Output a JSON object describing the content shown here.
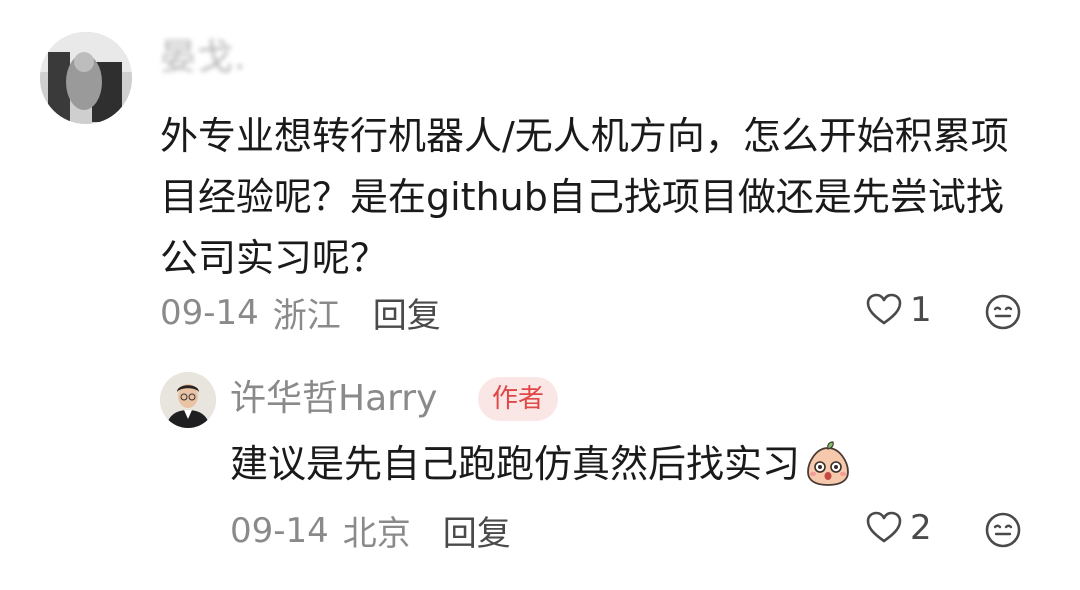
{
  "comment": {
    "username": "晏戈.",
    "text": "外专业想转行机器人/无人机方向，怎么开始积累项目经验呢？是在github自己找项目做还是先尝试找公司实习呢？",
    "date": "09-14",
    "region": "浙江",
    "reply_label": "回复",
    "likes": "1",
    "icons": {
      "like": "heart-outline-icon",
      "react": "smiley-face-icon"
    }
  },
  "reply": {
    "username": "许华哲Harry",
    "badge": "作者",
    "text": "建议是先自己跑跑仿真然后找实习",
    "emoji": "surprised-peach-emoji",
    "date": "09-14",
    "region": "北京",
    "reply_label": "回复",
    "likes": "2"
  },
  "colors": {
    "primary_text": "#1a1a1a",
    "secondary_text": "#8a8a8a",
    "badge_bg": "#fbe6e6",
    "badge_text": "#e04848"
  }
}
